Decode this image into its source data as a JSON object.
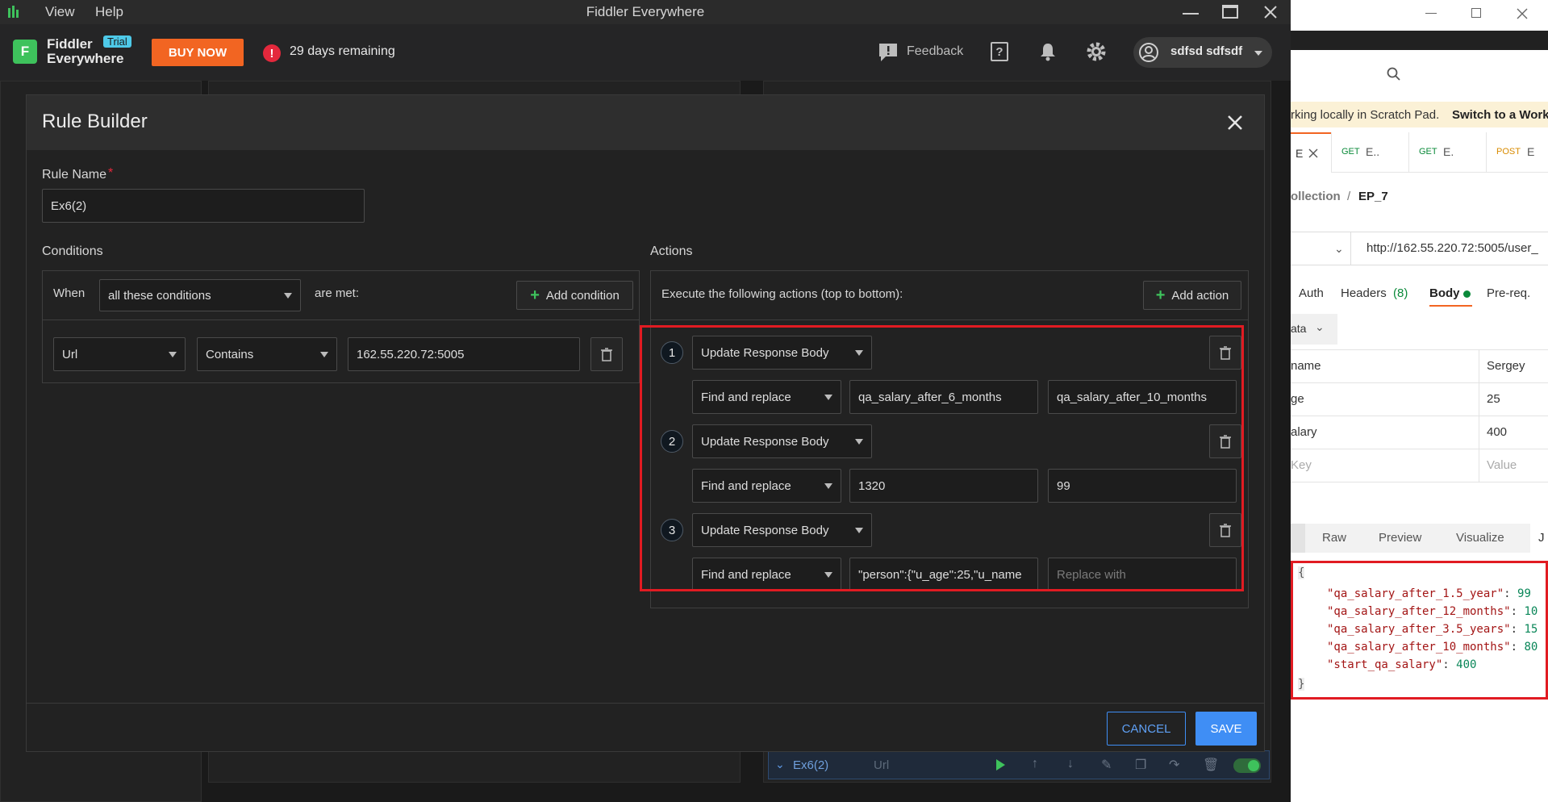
{
  "window": {
    "title": "Fiddler Everywhere",
    "menu": [
      "View",
      "Help"
    ]
  },
  "header": {
    "brand_line1": "Fiddler",
    "brand_line2": "Everywhere",
    "trial_badge": "Trial",
    "buy_now": "BUY NOW",
    "days_remaining": "29 days remaining",
    "feedback": "Feedback",
    "user_name": "sdfsd sdfsdf"
  },
  "modal": {
    "title": "Rule Builder",
    "rule_name_label": "Rule Name",
    "required_mark": "*",
    "rule_name_value": "Ex6(2)",
    "conditions": {
      "label": "Conditions",
      "when": "When",
      "match_mode": "all these conditions",
      "are_met": "are met:",
      "add_condition": "Add condition",
      "rows": [
        {
          "field": "Url",
          "operator": "Contains",
          "value": "162.55.220.72:5005"
        }
      ]
    },
    "actions": {
      "label": "Actions",
      "description": "Execute the following actions (top to bottom):",
      "add_action": "Add action",
      "items": [
        {
          "number": "1",
          "type": "Update Response Body",
          "mode": "Find and replace",
          "find": "qa_salary_after_6_months",
          "replace": "qa_salary_after_10_months",
          "replace_placeholder": ""
        },
        {
          "number": "2",
          "type": "Update Response Body",
          "mode": "Find and replace",
          "find": "1320",
          "replace": "99",
          "replace_placeholder": ""
        },
        {
          "number": "3",
          "type": "Update Response Body",
          "mode": "Find and replace",
          "find": "\"person\":{\"u_age\":25,\"u_name",
          "replace": "",
          "replace_placeholder": "Replace with"
        }
      ]
    },
    "cancel": "CANCEL",
    "save": "SAVE"
  },
  "background_rule": {
    "name": "Ex6(2)",
    "condition": "Url"
  },
  "postman": {
    "banner_text": "rking locally in Scratch Pad.",
    "banner_link": "Switch to a Work",
    "tabs": [
      {
        "method": "",
        "label": "E"
      },
      {
        "method": "GET",
        "label": "E.."
      },
      {
        "method": "GET",
        "label": "E."
      },
      {
        "method": "POST",
        "label": "E"
      }
    ],
    "breadcrumb_parent": "ollection",
    "breadcrumb_sep": "/",
    "breadcrumb_current": "EP_7",
    "url": "http://162.55.220.72:5005/user_",
    "req_tabs": {
      "auth": "Auth",
      "headers": "Headers",
      "headers_count": "(8)",
      "body": "Body",
      "prereq": "Pre-req."
    },
    "body_type": "ata",
    "form_rows": [
      {
        "key": "name",
        "value": "Sergey"
      },
      {
        "key": "ge",
        "value": "25"
      },
      {
        "key": "alary",
        "value": "400"
      },
      {
        "key": "Key",
        "value": "Value"
      }
    ],
    "resp_tabs": {
      "raw": "Raw",
      "preview": "Preview",
      "visualize": "Visualize",
      "extra": "J"
    },
    "response_lines": [
      {
        "key": "\"qa_salary_after_1.5_year\"",
        "value": "99"
      },
      {
        "key": "\"qa_salary_after_12_months\"",
        "value": "10"
      },
      {
        "key": "\"qa_salary_after_3.5_years\"",
        "value": "15"
      },
      {
        "key": "\"qa_salary_after_10_months\"",
        "value": "80"
      },
      {
        "key": "\"start_qa_salary\"",
        "value": "400"
      }
    ]
  },
  "colors": {
    "accent_orange": "#f26522",
    "highlight_red": "#e11b22",
    "save_blue": "#3f8ef5",
    "green": "#3ec25c"
  }
}
